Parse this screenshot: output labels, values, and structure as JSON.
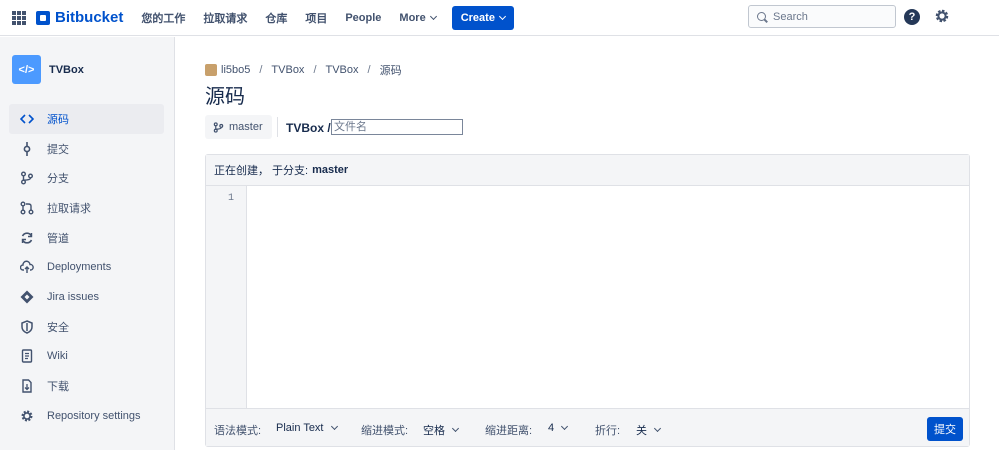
{
  "topnav": {
    "brand": "Bitbucket",
    "items": [
      "您的工作",
      "拉取请求",
      "仓库",
      "项目",
      "People"
    ],
    "more": "More",
    "create": "Create",
    "search_placeholder": "Search",
    "help": "?"
  },
  "sidebar": {
    "repo_name": "TVBox",
    "repo_avatar": "</>",
    "items": [
      {
        "label": "源码",
        "icon": "code-icon"
      },
      {
        "label": "提交",
        "icon": "commit-icon"
      },
      {
        "label": "分支",
        "icon": "branch-icon"
      },
      {
        "label": "拉取请求",
        "icon": "pull-request-icon"
      },
      {
        "label": "管道",
        "icon": "pipeline-icon"
      },
      {
        "label": "Deployments",
        "icon": "cloud-upload-icon"
      },
      {
        "label": "Jira issues",
        "icon": "jira-icon"
      },
      {
        "label": "安全",
        "icon": "shield-icon"
      },
      {
        "label": "Wiki",
        "icon": "document-icon"
      },
      {
        "label": "下载",
        "icon": "download-icon"
      },
      {
        "label": "Repository settings",
        "icon": "gear-icon"
      }
    ]
  },
  "breadcrumb": [
    "li5bo5",
    "TVBox",
    "TVBox",
    "源码"
  ],
  "page_title": "源码",
  "branch": "master",
  "path_prefix": "TVBox /",
  "filename_placeholder": "文件名",
  "editor": {
    "status_prefix": "正在创建， 于分支:",
    "status_branch": "master",
    "line_number": "1",
    "syntax_label": "语法模式:",
    "syntax_value": "Plain Text",
    "indent_mode_label": "缩进模式:",
    "indent_mode_value": "空格",
    "indent_size_label": "缩进距离:",
    "indent_size_value": "4",
    "wrap_label": "折行:",
    "wrap_value": "关",
    "commit_label": "提交"
  },
  "colors": {
    "accent": "#0052CC",
    "sidebar_bg": "#F4F5F7"
  }
}
